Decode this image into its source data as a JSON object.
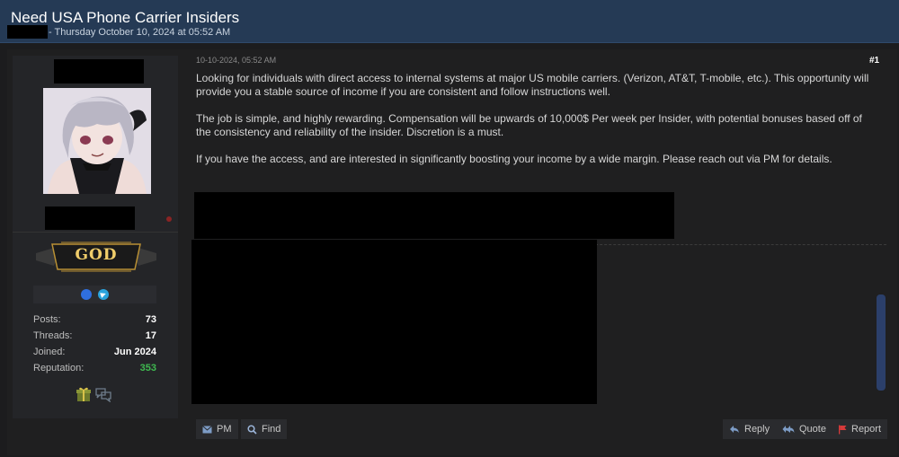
{
  "thread": {
    "title": "Need USA Phone Carrier Insiders",
    "meta_suffix": "- Thursday October 10, 2024 at 05:52 AM"
  },
  "author": {
    "rank_badge": "GOD",
    "stats": [
      {
        "label": "Posts:",
        "value": "73"
      },
      {
        "label": "Threads:",
        "value": "17"
      },
      {
        "label": "Joined:",
        "value": "Jun 2024"
      },
      {
        "label": "Reputation:",
        "value": "353",
        "color": "#3fb950"
      }
    ],
    "contact_icons": [
      "site-profile-icon",
      "telegram-icon"
    ],
    "award_icons": [
      "gift-icon",
      "chat-bubbles-icon"
    ]
  },
  "post": {
    "date": "10-10-2024, 05:52 AM",
    "number": "#1",
    "paragraphs": [
      "Looking for individuals with direct access to internal systems at major US mobile carriers. (Verizon, AT&T, T-mobile, etc.). This opportunity will provide you a stable source of income if you are consistent and follow instructions well.",
      "The job is simple, and highly rewarding. Compensation will be upwards of 10,000$ Per week per Insider, with potential bonuses based off of the consistency and reliability of the insider. Discretion is a must.",
      "If you have the access, and are interested in significantly boosting your income by a wide margin. Please reach out via PM for details."
    ]
  },
  "actions": {
    "pm": "PM",
    "find": "Find",
    "reply": "Reply",
    "quote": "Quote",
    "report": "Report"
  },
  "colors": {
    "header_bg": "#253a55",
    "page_bg": "#1c1c1e",
    "rank_gold": "#f0cd6a",
    "reputation_green": "#3fb950",
    "report_red": "#d83a3a"
  }
}
